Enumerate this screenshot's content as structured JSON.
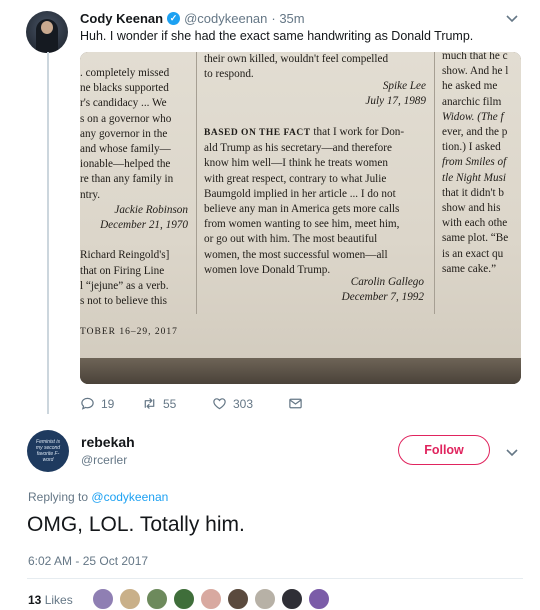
{
  "tweet": {
    "author_name": "Cody Keenan",
    "author_handle": "@codykeenan",
    "time": "· 35m",
    "text": "Huh. I wonder if she had the exact same handwriting as Donald Trump.",
    "replies": "19",
    "retweets": "55",
    "likes": "303",
    "photo": {
      "col1": [
        ". completely missed",
        "ne blacks supported",
        "r's candidacy ... We",
        "s on a governor who",
        "any governor in the",
        "and whose family—",
        "ionable—helped the",
        "re than any family in",
        "ntry.",
        "Jackie Robinson",
        "December 21, 1970",
        "",
        "Richard Reingold's]",
        "that on Firing Line",
        "l “jejune” as a verb.",
        "s not to believe this"
      ],
      "col1_footer": "TOBER 16–29, 2017",
      "col2_top": [
        "their own killed, wouldn't feel compelled",
        "to respond."
      ],
      "col2_sig1": [
        "Spike Lee",
        "July 17, 1989"
      ],
      "col2_body": [
        "BASED ON THE FACT that I work for Don-",
        "ald Trump as his secretary—and therefore",
        "know him well—I think he treats women",
        "with great respect, contrary to what Julie",
        "Baumgold implied in her article ... I do not",
        "believe any man in America gets more calls",
        "from women wanting to see him, meet him,",
        "or go out with him. The most beautiful",
        "women, the most successful women—all",
        "women love Donald Trump."
      ],
      "col2_sig2": [
        "Carolin Gallego",
        "December 7, 1992"
      ],
      "col3": [
        "much that he c",
        "show. And he l",
        "he asked me",
        "anarchic film",
        "Widow. (The f",
        "ever, and the p",
        "tion.) I asked",
        "from Smiles of",
        "tle Night Musi",
        "that it didn't b",
        "show and his",
        "with each othe",
        "same plot. “Be",
        "is an exact qu",
        "same cake.”"
      ]
    }
  },
  "reply": {
    "author_name": "rebekah",
    "author_handle": "@rcerler",
    "avatar_text": "Feminist is my second favorite F-word",
    "follow_label": "Follow",
    "replying_prefix": "Replying to",
    "replying_to": "@codykeenan",
    "text": "OMG, LOL. Totally him.",
    "timestamp": "6:02 AM - 25 Oct 2017",
    "likes_count": "13",
    "likes_label": "Likes"
  },
  "colors": {
    "accent": "#1da1f2",
    "follow": "#e0245e",
    "muted": "#657786"
  },
  "liker_colors": [
    "#8f7fb3",
    "#c9b089",
    "#6d8a5c",
    "#3f6e3a",
    "#d8a9a0",
    "#5a4a3e",
    "#b7b1a6",
    "#2f2f36",
    "#7b5ca8"
  ]
}
